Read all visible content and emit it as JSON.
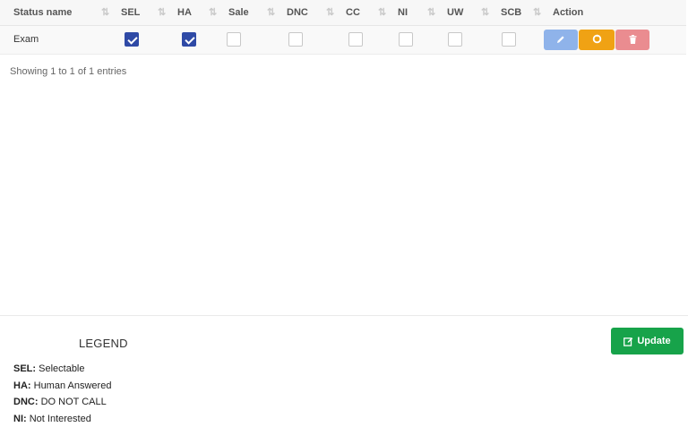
{
  "table": {
    "columns": [
      {
        "label": "Status name",
        "sort_icon": "sort-icon"
      },
      {
        "label": "SEL",
        "sort_icon": "sort-icon"
      },
      {
        "label": "HA",
        "sort_icon": "sort-icon"
      },
      {
        "label": "Sale",
        "sort_icon": "sort-icon"
      },
      {
        "label": "DNC",
        "sort_icon": "sort-icon"
      },
      {
        "label": "CC",
        "sort_icon": "sort-icon"
      },
      {
        "label": "NI",
        "sort_icon": "sort-icon"
      },
      {
        "label": "UW",
        "sort_icon": "sort-icon"
      },
      {
        "label": "SCB",
        "sort_icon": "sort-icon"
      },
      {
        "label": "Action"
      }
    ],
    "rows": [
      {
        "status_name": "Exam",
        "flags": {
          "SEL": true,
          "HA": true,
          "Sale": false,
          "DNC": false,
          "CC": false,
          "NI": false,
          "UW": false,
          "SCB": false
        },
        "actions": [
          "edit",
          "restore",
          "delete"
        ]
      }
    ]
  },
  "showing_text": "Showing 1 to 1 of 1 entries",
  "legend": {
    "title": "LEGEND",
    "items": [
      {
        "code": "SEL:",
        "desc": "Selectable"
      },
      {
        "code": "HA:",
        "desc": "Human Answered"
      },
      {
        "code": "DNC:",
        "desc": "DO NOT CALL"
      },
      {
        "code": "NI:",
        "desc": "Not Interested"
      }
    ]
  },
  "update_button": {
    "label": "Update",
    "icon": "edit-icon"
  },
  "colors": {
    "checkbox_checked": "#2f4aa6",
    "edit_button": "#8fb3ea",
    "restore_button": "#f0a214",
    "delete_button": "#ea8c90",
    "update_button": "#17a34a"
  }
}
